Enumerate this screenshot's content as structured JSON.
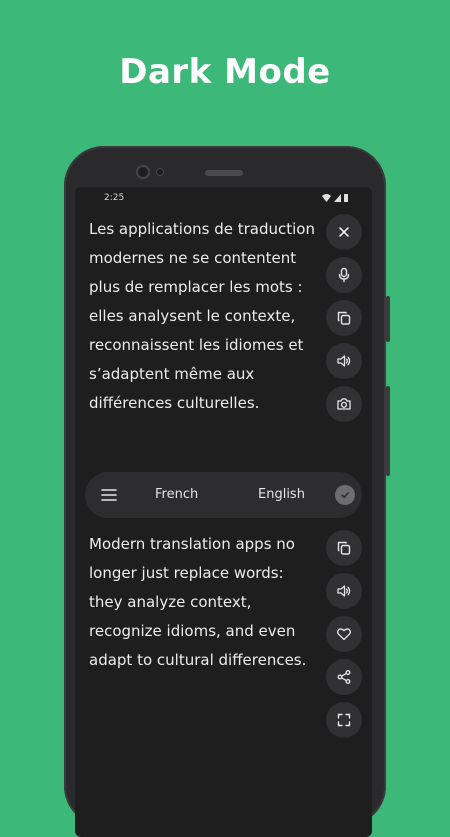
{
  "headline": "Dark Mode",
  "status_bar": {
    "time": "2:25",
    "icons": [
      "wifi-icon",
      "cellular-icon",
      "battery-icon"
    ]
  },
  "source": {
    "text": "Les applications de traduction modernes ne se contentent plus de remplacer les mots : elles analysent le contexte, reconnaissent les idiomes et s’adaptent même aux différences culturelles.",
    "actions": [
      "close-icon",
      "microphone-icon",
      "copy-icon",
      "speaker-icon",
      "camera-icon"
    ]
  },
  "language_bar": {
    "from": "French",
    "to": "English",
    "icons": [
      "menu-icon",
      "check-icon"
    ]
  },
  "target": {
    "text": "Modern translation apps no longer just replace words: they analyze context, recognize idioms, and even adapt to cultural differences.",
    "actions": [
      "copy-icon",
      "speaker-icon",
      "heart-icon",
      "share-icon",
      "fullscreen-icon"
    ]
  },
  "colors": {
    "background": "#3cb878",
    "screen": "#1e1e1f",
    "button": "#313133",
    "text": "#ececec"
  }
}
